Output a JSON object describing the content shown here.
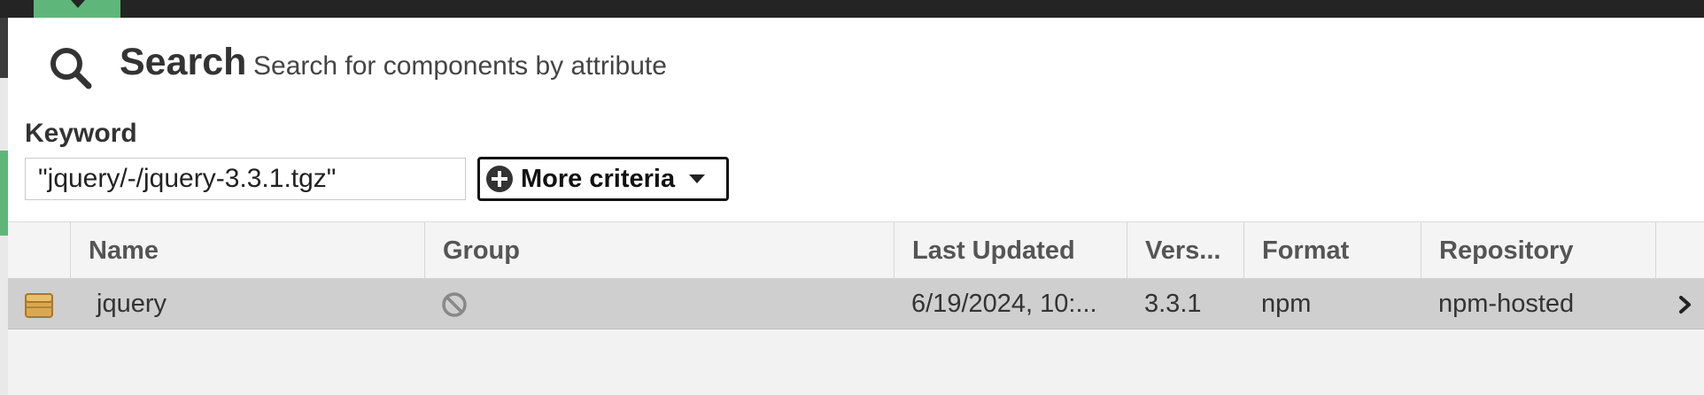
{
  "header": {
    "title": "Search",
    "subtitle": "Search for components by attribute"
  },
  "keyword": {
    "label": "Keyword",
    "value": "\"jquery/-/jquery-3.3.1.tgz\""
  },
  "more_criteria": {
    "label": "More criteria"
  },
  "table": {
    "columns": [
      "Name",
      "Group",
      "Last Updated",
      "Vers...",
      "Format",
      "Repository"
    ],
    "rows": [
      {
        "name": "jquery",
        "group_icon": "no-group-icon",
        "last_updated": "6/19/2024, 10:...",
        "version": "3.3.1",
        "format": "npm",
        "repository": "npm-hosted"
      }
    ]
  },
  "colors": {
    "accent_green": "#5fb67a",
    "topbar": "#242424",
    "selected_row": "#cfcfcf"
  },
  "icons": {
    "search": "search-icon",
    "more_criteria": "plus-circle-icon",
    "row": "component-box-icon",
    "row_action": "chevron-right-icon"
  }
}
